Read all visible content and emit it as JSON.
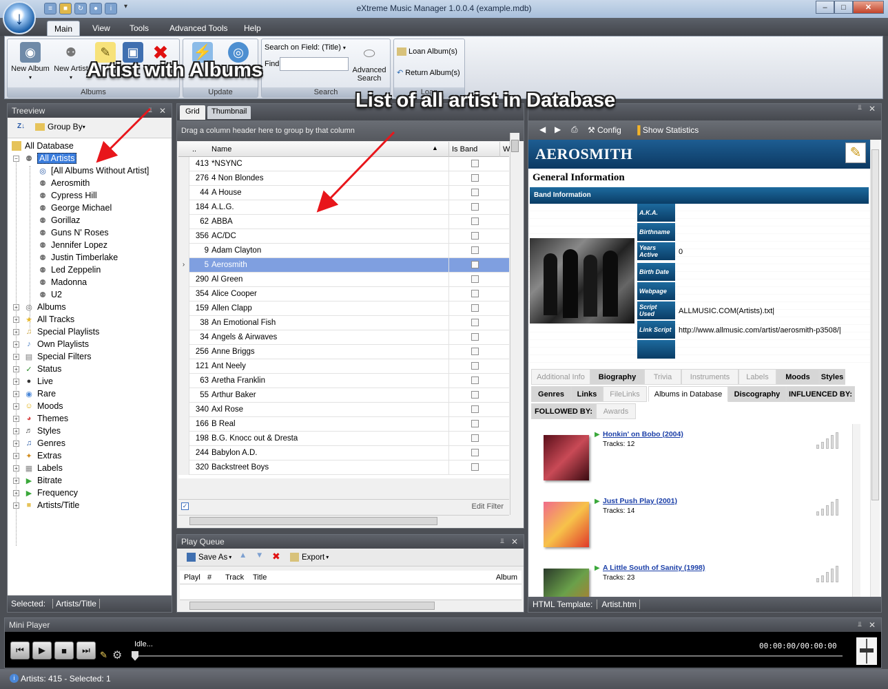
{
  "window": {
    "title": "eXtreme Music Manager 1.0.0.4 (example.mdb)"
  },
  "ribbon_tabs": [
    "Main",
    "View",
    "Tools",
    "Advanced Tools",
    "Help"
  ],
  "ribbon": {
    "albums_group": "Albums",
    "update_group": "Update",
    "search_group": "Search",
    "loan_group": "Loan",
    "new_album": "New Album",
    "new_artist": "New Artist",
    "search_field_label": "Search on Field: (Title)",
    "find_label": "Find",
    "advanced_search_1": "Advanced",
    "advanced_search_2": "Search",
    "loan_albums": "Loan Album(s)",
    "return_albums": "Return Album(s)"
  },
  "annotations": {
    "artist_with_albums": "Artist with Albums",
    "list_of_artists": "List of all artist in Database"
  },
  "treeview": {
    "title": "Treeview",
    "group_by": "Group By",
    "root": "All Database",
    "all_artists": "All Artists",
    "artists": [
      "[All Albums Without Artist]",
      "Aerosmith",
      "Cypress Hill",
      "George Michael",
      "Gorillaz",
      "Guns N' Roses",
      "Jennifer Lopez",
      "Justin Timberlake",
      "Led Zeppelin",
      "Madonna",
      "U2"
    ],
    "categories": [
      "Albums",
      "All Tracks",
      "Special Playlists",
      "Own Playlists",
      "Special Filters",
      "Status",
      "Live",
      "Rare",
      "Moods",
      "Themes",
      "Styles",
      "Genres",
      "Extras",
      "Labels",
      "Bitrate",
      "Frequency",
      "Artists/Title"
    ],
    "selected_label": "Selected:",
    "selected_value": "Artists/Title"
  },
  "grid": {
    "tab_grid": "Grid",
    "tab_thumbnail": "Thumbnail",
    "group_hint": "Drag a column header here to group by that column",
    "col_dots": "..",
    "col_name": "Name",
    "col_isband": "Is Band",
    "col_w": "W",
    "edit_filter": "Edit Filter",
    "rows": [
      {
        "id": "413",
        "name": "*NSYNC",
        "band": false
      },
      {
        "id": "276",
        "name": "4 Non Blondes",
        "band": false
      },
      {
        "id": "44",
        "name": "A House",
        "band": false
      },
      {
        "id": "184",
        "name": "A.L.G.",
        "band": false
      },
      {
        "id": "62",
        "name": "ABBA",
        "band": false
      },
      {
        "id": "356",
        "name": "AC/DC",
        "band": false
      },
      {
        "id": "9",
        "name": "Adam Clayton",
        "band": false
      },
      {
        "id": "5",
        "name": "Aerosmith",
        "band": true,
        "selected": true
      },
      {
        "id": "290",
        "name": "Al Green",
        "band": false
      },
      {
        "id": "354",
        "name": "Alice Cooper",
        "band": false
      },
      {
        "id": "159",
        "name": "Allen Clapp",
        "band": false
      },
      {
        "id": "38",
        "name": "An Emotional Fish",
        "band": false
      },
      {
        "id": "34",
        "name": "Angels & Airwaves",
        "band": false
      },
      {
        "id": "256",
        "name": "Anne Briggs",
        "band": false
      },
      {
        "id": "121",
        "name": "Ant Neely",
        "band": false
      },
      {
        "id": "63",
        "name": "Aretha Franklin",
        "band": false
      },
      {
        "id": "55",
        "name": "Arthur Baker",
        "band": false
      },
      {
        "id": "340",
        "name": "Axl Rose",
        "band": false
      },
      {
        "id": "166",
        "name": "B Real",
        "band": false
      },
      {
        "id": "198",
        "name": "B.G. Knocc out & Dresta",
        "band": false
      },
      {
        "id": "244",
        "name": "Babylon A.D.",
        "band": false
      },
      {
        "id": "320",
        "name": "Backstreet Boys",
        "band": false
      }
    ]
  },
  "queue": {
    "title": "Play Queue",
    "save_as": "Save As",
    "export": "Export",
    "cols": [
      "Playl",
      "#",
      "Track",
      "Title",
      "Album"
    ]
  },
  "html_view": {
    "config": "Config",
    "show_statistics": "Show Statistics",
    "artist_name": "AEROSMITH",
    "general_info": "General Information",
    "band_info": "Band Information",
    "labels": [
      "A.K.A.",
      "Birthname",
      "Years Active",
      "Birth Date",
      "Webpage",
      "Script Used",
      "Link Script"
    ],
    "years_active_value": "0",
    "script_used_value": "ALLMUSIC.COM(Artists).txt|",
    "link_script_value": "http://www.allmusic.com/artist/aerosmith-p3508/|",
    "tabs_row1": [
      "Additional Info",
      "Biography",
      "Trivia",
      "Instruments",
      "Labels",
      "Moods",
      "Styles"
    ],
    "tabs_row2": [
      "Genres",
      "Links",
      "FileLinks",
      "Albums in Database",
      "Discography",
      "INFLUENCED BY:"
    ],
    "tabs_row3": [
      "FOLLOWED BY:",
      "Awards"
    ],
    "albums": [
      {
        "title": "Honkin' on Bobo (2004)",
        "tracks": "Tracks: 12"
      },
      {
        "title": "Just Push Play (2001)",
        "tracks": "Tracks: 14"
      },
      {
        "title": "A Little South of Sanity (1998)",
        "tracks": "Tracks: 23"
      }
    ],
    "template_label": "HTML Template:",
    "template_value": "Artist.htm"
  },
  "mini_player": {
    "title": "Mini Player",
    "status": "Idle...",
    "time": "00:00:00/00:00:00"
  },
  "statusbar": {
    "text": "Artists: 415 - Selected: 1"
  }
}
